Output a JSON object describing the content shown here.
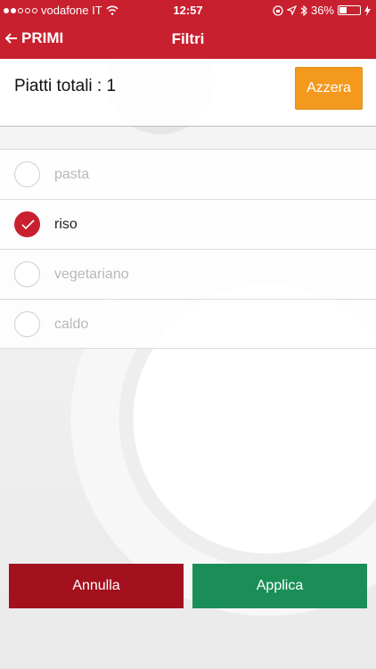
{
  "status_bar": {
    "carrier": "vodafone IT",
    "time": "12:57",
    "battery_percent": "36%",
    "icons": [
      "signal-dots-icon",
      "wifi-icon",
      "lock-rotation-icon",
      "location-arrow-icon",
      "bluetooth-icon",
      "battery-icon",
      "charging-bolt-icon"
    ],
    "signal_strength": 2,
    "battery_level": 0.36
  },
  "nav": {
    "back_label": "PRIMI",
    "title": "Filtri"
  },
  "summary": {
    "label": "Piatti totali : 1",
    "reset_label": "Azzera"
  },
  "filters": [
    {
      "label": "pasta",
      "checked": false
    },
    {
      "label": "riso",
      "checked": true
    },
    {
      "label": "vegetariano",
      "checked": false
    },
    {
      "label": "caldo",
      "checked": false
    }
  ],
  "actions": {
    "cancel_label": "Annulla",
    "apply_label": "Applica"
  },
  "colors": {
    "header": "#c8202f",
    "reset": "#f39a1e",
    "cancel": "#a3111f",
    "apply": "#1b8e57",
    "check": "#c8202f"
  }
}
